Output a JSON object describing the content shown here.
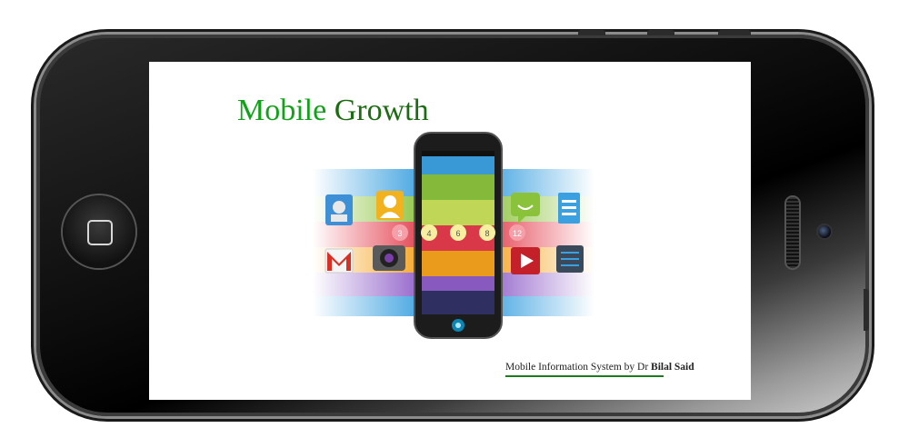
{
  "slide": {
    "title_word1": "Mobile",
    "title_word2": "Growth",
    "footer_prefix": "Mobile Information System by Dr",
    "footer_name": "Bilal Said"
  },
  "phone_art": {
    "badges": [
      "3",
      "4",
      "6",
      "8",
      "12"
    ]
  },
  "colors": {
    "title_accent": "#12a21a",
    "title_dark": "#1d6b12",
    "footer_rule": "#1f7a1f"
  },
  "icons": [
    "home-button-icon",
    "contacts-icon",
    "people-icon",
    "messaging-icon",
    "docs-icon",
    "gmail-icon",
    "camera-icon",
    "youtube-icon",
    "settings-icon"
  ]
}
